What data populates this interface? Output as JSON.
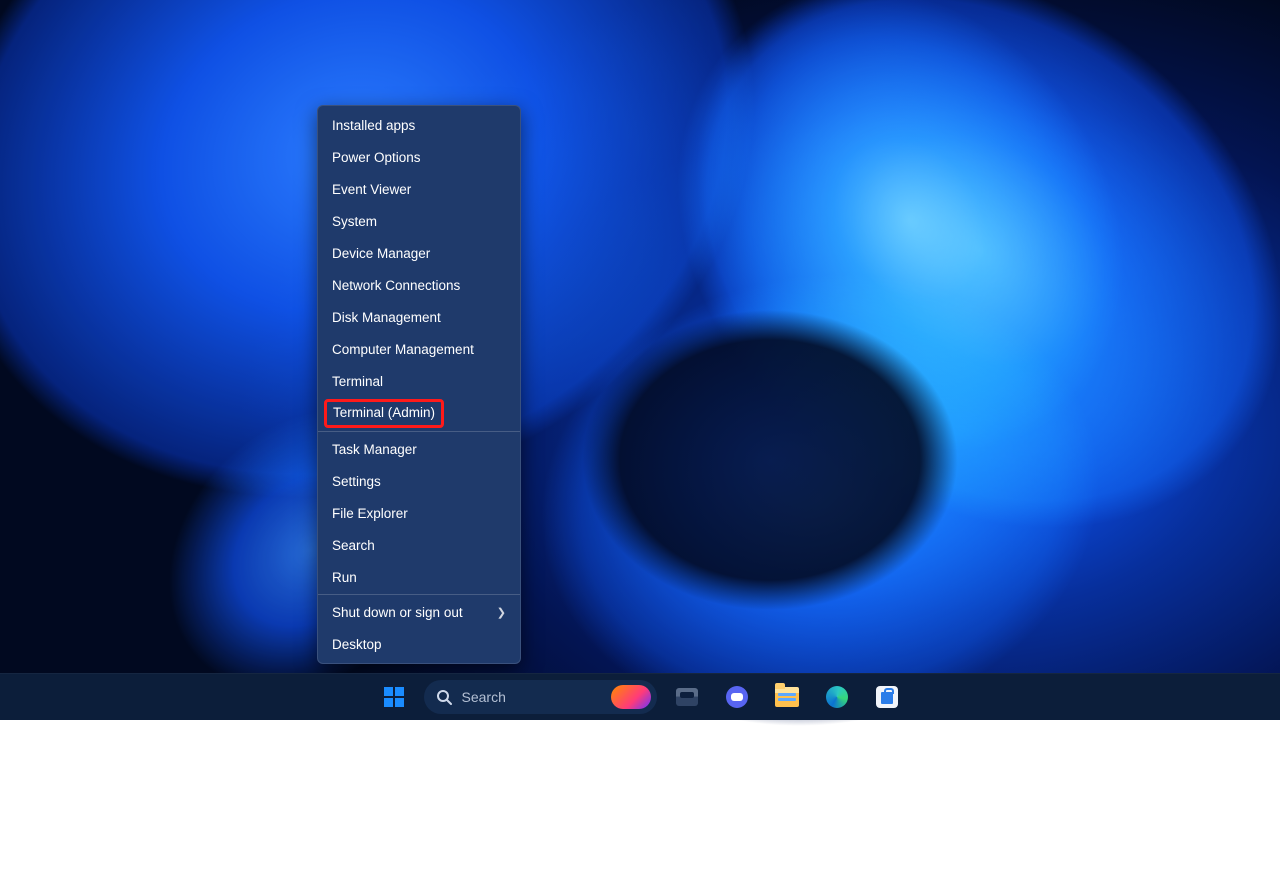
{
  "context_menu": {
    "items": [
      {
        "label": "Installed apps",
        "submenu": false
      },
      {
        "label": "Power Options",
        "submenu": false
      },
      {
        "label": "Event Viewer",
        "submenu": false
      },
      {
        "label": "System",
        "submenu": false
      },
      {
        "label": "Device Manager",
        "submenu": false
      },
      {
        "label": "Network Connections",
        "submenu": false
      },
      {
        "label": "Disk Management",
        "submenu": false
      },
      {
        "label": "Computer Management",
        "submenu": false
      },
      {
        "label": "Terminal",
        "submenu": false
      },
      {
        "label": "Terminal (Admin)",
        "submenu": false,
        "highlighted": true
      },
      {
        "separator": true
      },
      {
        "label": "Task Manager",
        "submenu": false
      },
      {
        "label": "Settings",
        "submenu": false
      },
      {
        "label": "File Explorer",
        "submenu": false
      },
      {
        "label": "Search",
        "submenu": false
      },
      {
        "label": "Run",
        "submenu": false
      },
      {
        "separator": true
      },
      {
        "label": "Shut down or sign out",
        "submenu": true
      },
      {
        "label": "Desktop",
        "submenu": false
      }
    ]
  },
  "taskbar": {
    "search_label": "Search",
    "icons": {
      "start": "start-button",
      "search": "search-box",
      "task_view": "task-view",
      "chat": "chat",
      "file_explorer": "file-explorer",
      "edge": "microsoft-edge",
      "store": "microsoft-store"
    }
  }
}
